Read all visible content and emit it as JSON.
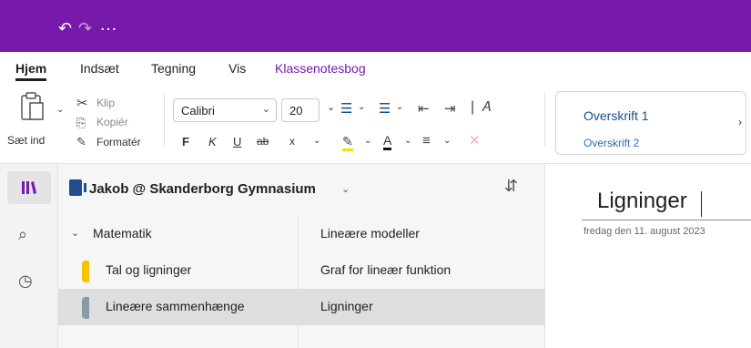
{
  "titlebar": {
    "undo_icon": "undo-icon",
    "redo_icon": "redo-icon",
    "more_icon": "more-icon",
    "color": "#7719aa"
  },
  "tabs": [
    {
      "label": "Hjem",
      "active": true
    },
    {
      "label": "Indsæt"
    },
    {
      "label": "Tegning"
    },
    {
      "label": "Vis"
    },
    {
      "label": "Klassenotesbog",
      "accent": true
    }
  ],
  "ribbon": {
    "paste_label": "Sæt ind",
    "cut_label": "Klip",
    "copy_label": "Kopiér",
    "format_label": "Formatér",
    "font_name": "Calibri",
    "font_size": "20",
    "bold": "F",
    "italic": "K",
    "underline": "U",
    "strike": "ab",
    "subscript": "x",
    "styles": {
      "heading1": "Overskrift 1",
      "heading2": "Overskrift 2"
    }
  },
  "notebook": {
    "title": "Jakob @ Skanderborg Gymnasium",
    "color": "#1e4e8c"
  },
  "sections": [
    {
      "label": "Matematik",
      "group": true
    },
    {
      "label": "Tal og ligninger",
      "color": "#f6c200"
    },
    {
      "label": "Lineære sammenhænge",
      "color": "#8a9aa4",
      "selected": true
    }
  ],
  "pages": [
    {
      "label": "Lineære modeller"
    },
    {
      "label": "Graf for lineær funktion"
    },
    {
      "label": "Ligninger",
      "selected": true
    }
  ],
  "page": {
    "title": "Ligninger",
    "date": "fredag den 11. august 2023"
  }
}
